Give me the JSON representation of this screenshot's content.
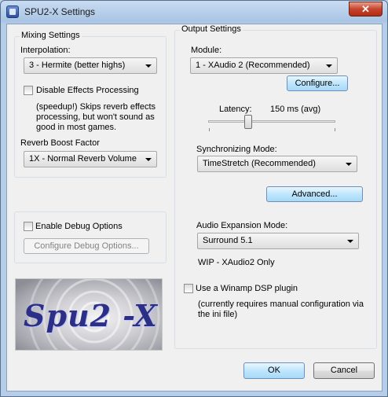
{
  "window": {
    "title": "SPU2-X Settings",
    "close_glyph": "✕"
  },
  "mixing": {
    "title": "Mixing Settings",
    "interpolation_label": "Interpolation:",
    "interpolation_value": "3 - Hermite (better highs)",
    "disable_effects_label": "Disable Effects Processing",
    "disable_effects_checked": false,
    "effects_note_lines": [
      "(speedup!) Skips reverb effects",
      "processing, but won't sound as",
      "good in most games."
    ],
    "reverb_label": "Reverb Boost Factor",
    "reverb_value": "1X - Normal Reverb Volume"
  },
  "debug": {
    "enable_label": "Enable Debug Options",
    "enable_checked": false,
    "configure_label": "Configure Debug Options..."
  },
  "logo": {
    "text": "Spu2 -X"
  },
  "output": {
    "title": "Output Settings",
    "module_label": "Module:",
    "module_value": "1 - XAudio 2 (Recommended)",
    "configure_label": "Configure...",
    "latency_label": "Latency:",
    "latency_value": "150 ms (avg)",
    "latency_slider_fraction": 0.3,
    "sync_label": "Synchronizing Mode:",
    "sync_value": "TimeStretch (Recommended)",
    "advanced_label": "Advanced...",
    "expansion_label": "Audio Expansion Mode:",
    "expansion_value": "Surround 5.1",
    "wip_note": "WIP - XAudio2 Only",
    "winamp_label": "Use a Winamp DSP plugin",
    "winamp_checked": false,
    "winamp_note_lines": [
      "(currently requires manual configuration via",
      "the ini file)"
    ]
  },
  "buttons": {
    "ok": "OK",
    "cancel": "Cancel"
  }
}
